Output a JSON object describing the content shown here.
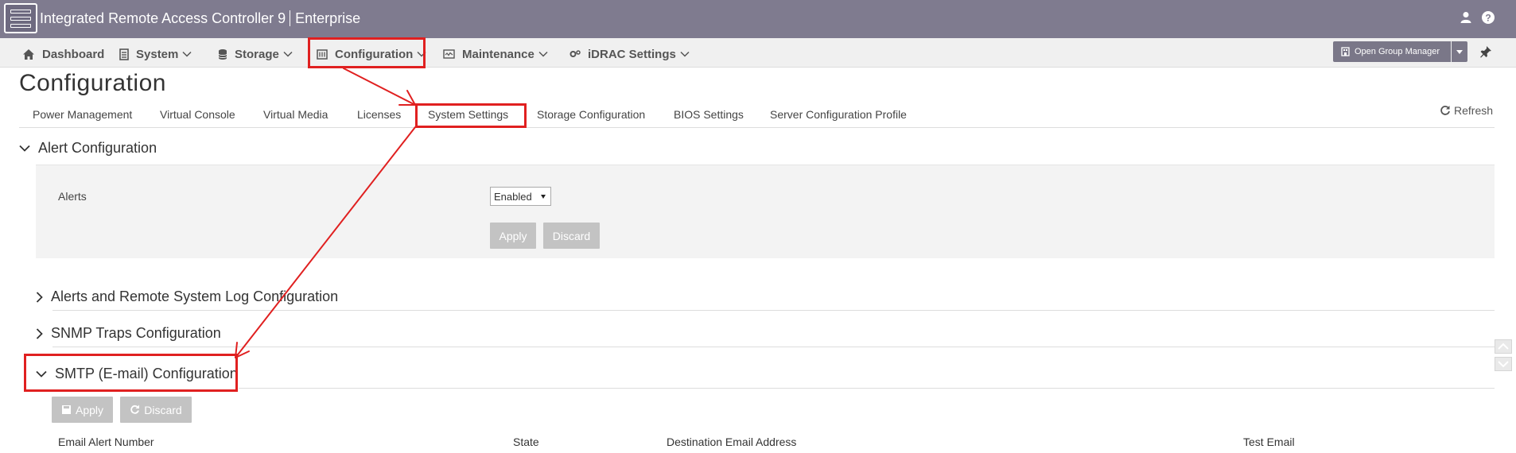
{
  "header": {
    "app_title": "Integrated Remote Access Controller 9",
    "edition": "Enterprise"
  },
  "nav": {
    "items": [
      {
        "label": "Dashboard",
        "icon": "home-icon"
      },
      {
        "label": "System",
        "icon": "server-icon"
      },
      {
        "label": "Storage",
        "icon": "database-icon"
      },
      {
        "label": "Configuration",
        "icon": "config-icon"
      },
      {
        "label": "Maintenance",
        "icon": "maintenance-icon"
      },
      {
        "label": "iDRAC Settings",
        "icon": "gears-icon"
      }
    ],
    "open_group_manager": "Open Group Manager"
  },
  "page": {
    "title": "Configuration",
    "refresh": "Refresh"
  },
  "subtabs": [
    "Power Management",
    "Virtual Console",
    "Virtual Media",
    "Licenses",
    "System Settings",
    "Storage Configuration",
    "BIOS Settings",
    "Server Configuration Profile"
  ],
  "sections": {
    "alert_configuration": "Alert Configuration",
    "alerts_remote_syslog": "Alerts and Remote System Log Configuration",
    "snmp_traps": "SNMP Traps Configuration",
    "smtp": "SMTP (E-mail) Configuration"
  },
  "alert_panel": {
    "label": "Alerts",
    "selected": "Enabled",
    "apply": "Apply",
    "discard": "Discard"
  },
  "smtp_panel": {
    "apply": "Apply",
    "discard": "Discard",
    "columns": [
      "Email Alert Number",
      "State",
      "Destination Email Address",
      "Test Email"
    ]
  },
  "colors": {
    "header_bg": "#7f7b8f",
    "annotation_red": "#e02020",
    "disabled_button": "#c3c3c3"
  }
}
